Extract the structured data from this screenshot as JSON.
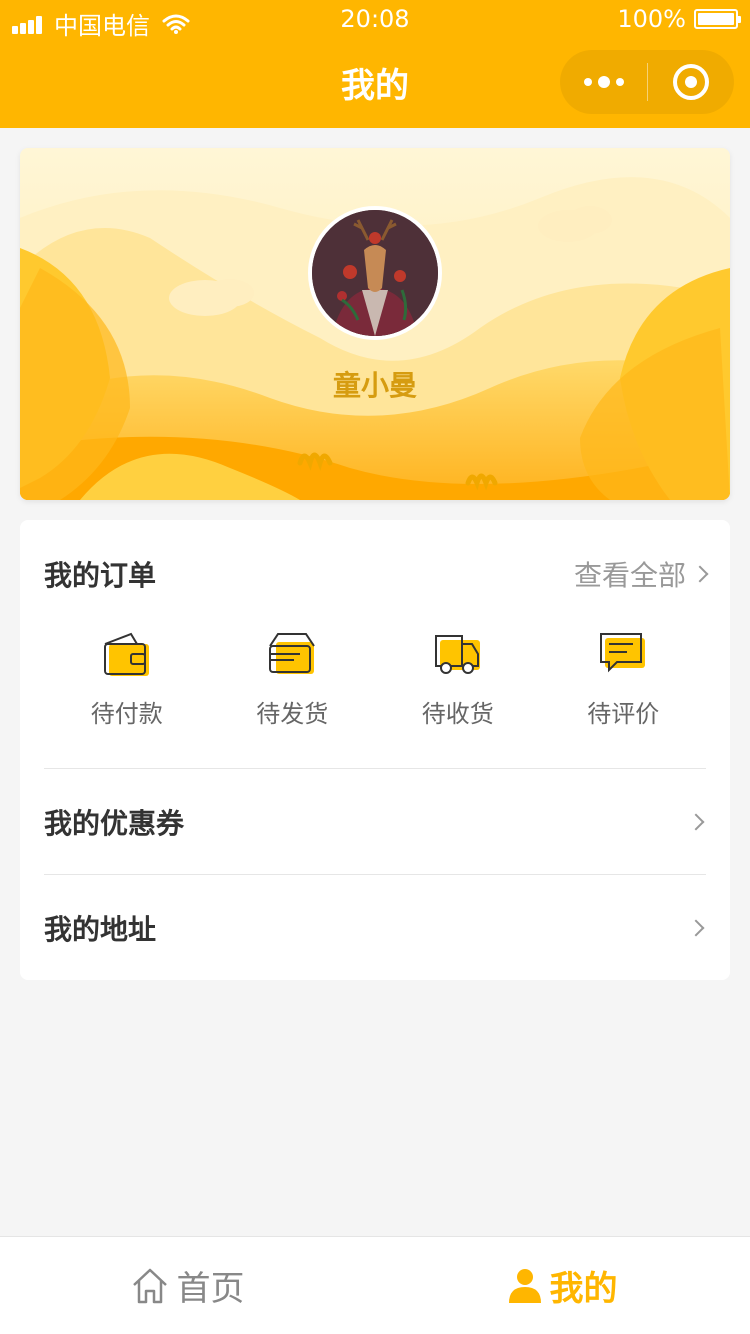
{
  "status_bar": {
    "carrier": "中国电信",
    "time": "20:08",
    "battery": "100%"
  },
  "nav": {
    "title": "我的"
  },
  "profile": {
    "username": "童小曼"
  },
  "orders": {
    "title": "我的订单",
    "view_all": "查看全部",
    "items": [
      {
        "label": "待付款",
        "icon": "wallet-icon"
      },
      {
        "label": "待发货",
        "icon": "package-icon"
      },
      {
        "label": "待收货",
        "icon": "truck-icon"
      },
      {
        "label": "待评价",
        "icon": "comment-icon"
      }
    ]
  },
  "menu": {
    "coupons": "我的优惠券",
    "address": "我的地址"
  },
  "tab_bar": {
    "home": "首页",
    "mine": "我的"
  },
  "colors": {
    "brand": "#ffb600",
    "username": "#d69c10"
  }
}
